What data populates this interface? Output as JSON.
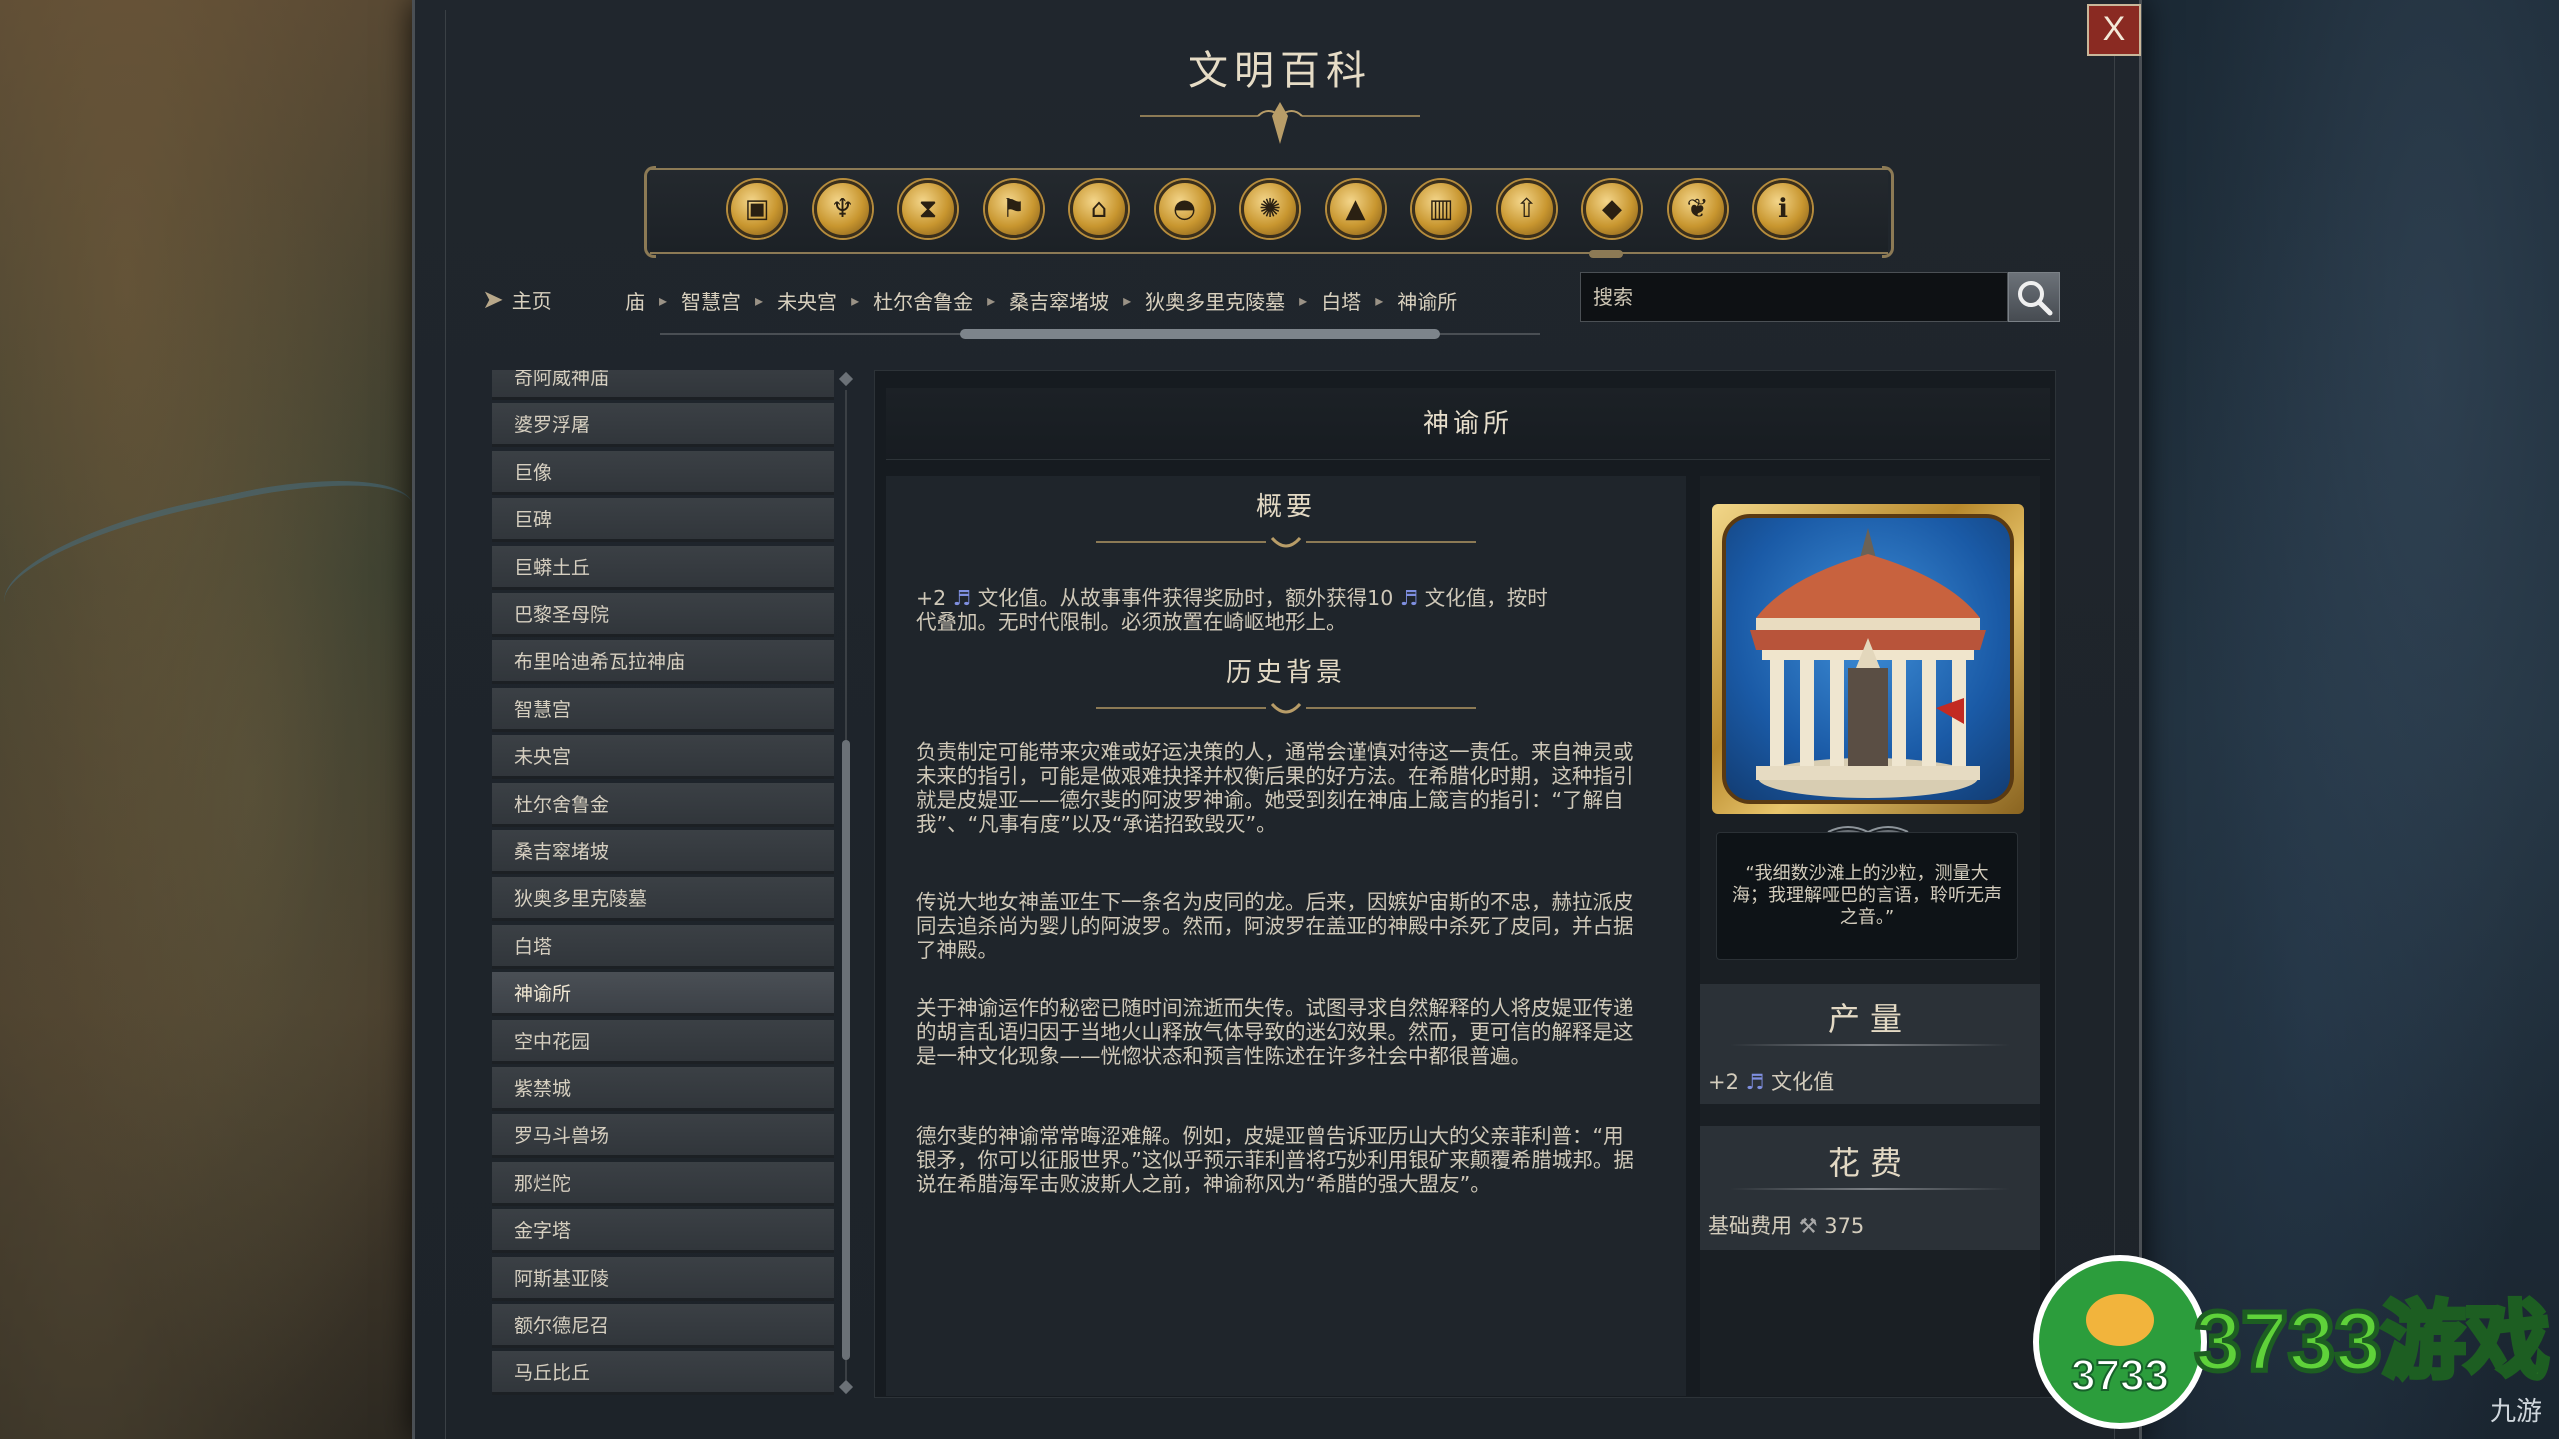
{
  "window": {
    "title": "文明百科",
    "close_label": "X"
  },
  "categories": [
    {
      "name": "gifts-icon",
      "glyph": "▣"
    },
    {
      "name": "goblet-icon",
      "glyph": "♆"
    },
    {
      "name": "hourglass-icon",
      "glyph": "⧗"
    },
    {
      "name": "flag-icon",
      "glyph": "⚑"
    },
    {
      "name": "building-icon",
      "glyph": "⌂"
    },
    {
      "name": "helmet-icon",
      "glyph": "◓"
    },
    {
      "name": "atom-icon",
      "glyph": "✺"
    },
    {
      "name": "mountains-icon",
      "glyph": "▲"
    },
    {
      "name": "city-icon",
      "glyph": "▥"
    },
    {
      "name": "upgrade-arrow-icon",
      "glyph": "⇧"
    },
    {
      "name": "wonder-icon",
      "glyph": "◆"
    },
    {
      "name": "dove-icon",
      "glyph": "❦"
    },
    {
      "name": "info-icon",
      "glyph": "ℹ"
    }
  ],
  "nav": {
    "home_label": "主页",
    "breadcrumbs": [
      "庙",
      "智慧宫",
      "未央宫",
      "杜尔舍鲁金",
      "桑吉窣堵坡",
      "狄奥多里克陵墓",
      "白塔",
      "神谕所"
    ]
  },
  "search": {
    "placeholder": "搜索"
  },
  "list": {
    "items": [
      "奇阿威神庙",
      "婆罗浮屠",
      "巨像",
      "巨碑",
      "巨蟒土丘",
      "巴黎圣母院",
      "布里哈迪希瓦拉神庙",
      "智慧宫",
      "未央宫",
      "杜尔舍鲁金",
      "桑吉窣堵坡",
      "狄奥多里克陵墓",
      "白塔",
      "神谕所",
      "空中花园",
      "紫禁城",
      "罗马斗兽场",
      "那烂陀",
      "金字塔",
      "阿斯基亚陵",
      "额尔德尼召",
      "马丘比丘"
    ],
    "active_index": 13
  },
  "article": {
    "title": "神谕所",
    "overview_title": "概要",
    "overview_prefix": "+2",
    "overview_line1": "文化值。从故事事件获得奖励时，额外获得10",
    "overview_line1b": "文化值，按时",
    "overview_line2": "代叠加。无时代限制。必须放置在崎岖地形上。",
    "history_title": "历史背景",
    "history_p1": "负责制定可能带来灾难或好运决策的人，通常会谨慎对待这一责任。来自神灵或未来的指引，可能是做艰难抉择并权衡后果的好方法。在希腊化时期，这种指引就是皮媞亚——德尔斐的阿波罗神谕。她受到刻在神庙上箴言的指引：“了解自我”、“凡事有度”以及“承诺招致毁灭”。",
    "history_p2": "传说大地女神盖亚生下一条名为皮同的龙。后来，因嫉妒宙斯的不忠，赫拉派皮同去追杀尚为婴儿的阿波罗。然而，阿波罗在盖亚的神殿中杀死了皮同，并占据了神殿。",
    "history_p3": "关于神谕运作的秘密已随时间流逝而失传。试图寻求自然解释的人将皮媞亚传递的胡言乱语归因于当地火山释放气体导致的迷幻效果。然而，更可信的解释是这是一种文化现象——恍惚状态和预言性陈述在许多社会中都很普遍。",
    "history_p4": "德尔斐的神谕常常晦涩难解。例如，皮媞亚曾告诉亚历山大的父亲菲利普：“用银矛，你可以征服世界。”这似乎预示菲利普将巧妙利用银矿来颠覆希腊城邦。据说在希腊海军击败波斯人之前，神谕称风为“希腊的强大盟友”。"
  },
  "sidebar": {
    "quote": "“我细数沙滩上的沙粒，测量大海；我理解哑巴的言语，聆听无声之音。”",
    "yield_title": "产量",
    "yield_amount": "+2",
    "yield_label": "文化值",
    "cost_title": "花费",
    "cost_label": "基础费用",
    "cost_value": "375"
  },
  "watermark": {
    "badge_text": "3733",
    "brand_text": "3733游戏",
    "sub_text": "九游"
  },
  "colors": {
    "accent_gold": "#c8962f",
    "culture_note": "#7f8fe0",
    "close_red": "#8a2a22"
  }
}
